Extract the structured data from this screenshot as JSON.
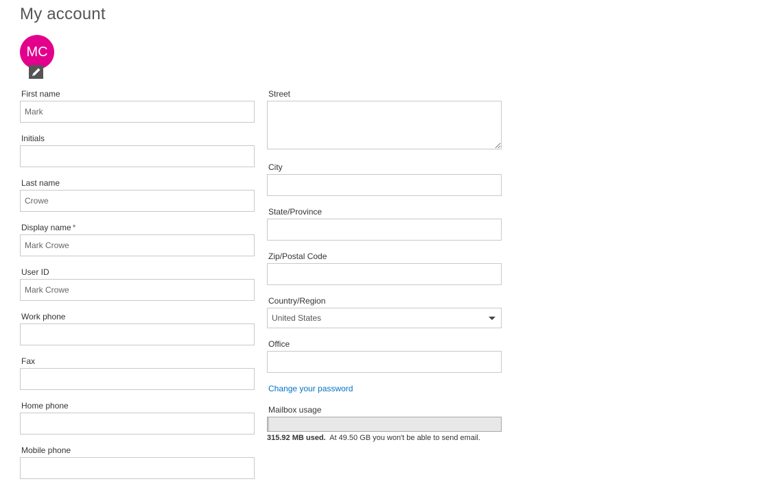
{
  "page": {
    "title": "My account"
  },
  "avatar": {
    "initials": "MC",
    "color": "#e3008c",
    "edit_icon": "pencil-icon"
  },
  "left_fields": [
    {
      "label": "First name",
      "value": "Mark",
      "required": false
    },
    {
      "label": "Initials",
      "value": "",
      "required": false
    },
    {
      "label": "Last name",
      "value": "Crowe",
      "required": false
    },
    {
      "label": "Display name",
      "value": "Mark Crowe",
      "required": true,
      "required_marker": "*"
    },
    {
      "label": "User ID",
      "value": "Mark Crowe",
      "required": false
    },
    {
      "label": "Work phone",
      "value": "",
      "required": false
    },
    {
      "label": "Fax",
      "value": "",
      "required": false
    },
    {
      "label": "Home phone",
      "value": "",
      "required": false
    },
    {
      "label": "Mobile phone",
      "value": "",
      "required": false
    }
  ],
  "right_fields": {
    "street": {
      "label": "Street",
      "value": ""
    },
    "city": {
      "label": "City",
      "value": ""
    },
    "state": {
      "label": "State/Province",
      "value": ""
    },
    "zip": {
      "label": "Zip/Postal Code",
      "value": ""
    },
    "country": {
      "label": "Country/Region",
      "value": "United States",
      "icon": "chevron-down-icon"
    },
    "office": {
      "label": "Office",
      "value": ""
    }
  },
  "password_link": "Change your password",
  "mailbox": {
    "label": "Mailbox usage",
    "used_text": "315.92 MB used.",
    "limit_text": "At 49.50 GB you won't be able to send email.",
    "usage_fraction": 0.006
  },
  "colors": {
    "accent_link": "#0072c6",
    "input_border": "#c8c8c8",
    "avatar_bg": "#e3008c"
  }
}
